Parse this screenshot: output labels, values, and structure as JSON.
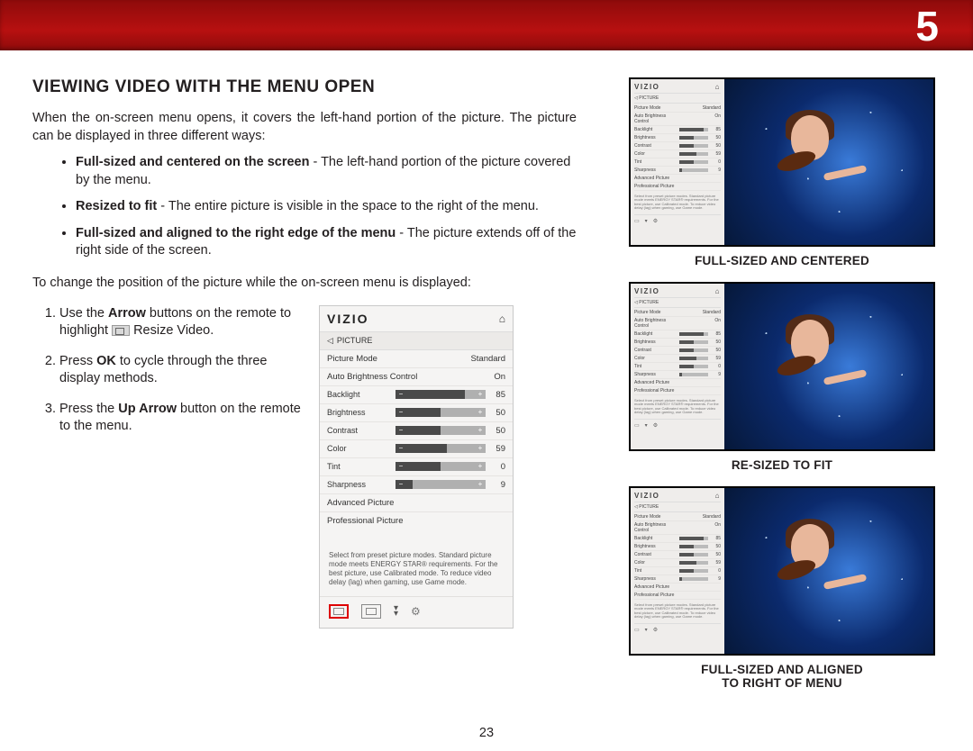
{
  "chapter": "5",
  "page_number": "23",
  "heading": "VIEWING VIDEO WITH THE MENU OPEN",
  "intro": "When the on-screen menu opens, it covers the left-hand portion of the picture. The picture can be displayed in three different ways:",
  "bullets": [
    {
      "bold": "Full-sized and centered on the screen",
      "rest": " - The left-hand portion of the picture covered by the menu."
    },
    {
      "bold": "Resized to fit",
      "rest": " - The entire picture is visible in the space to the right of the menu."
    },
    {
      "bold": "Full-sized and aligned to the right edge of the menu",
      "rest": " - The picture extends off of the right side of the screen."
    }
  ],
  "para2": "To change the position of the picture while the on-screen menu is displayed:",
  "steps": {
    "s1a": "Use the ",
    "s1b": "Arrow",
    "s1c": " buttons on the remote to highlight ",
    "s1d": " Resize Video.",
    "s2a": "Press ",
    "s2b": "OK",
    "s2c": " to cycle through the three display methods.",
    "s3a": "Press the ",
    "s3b": "Up Arrow",
    "s3c": " button on the remote to the menu."
  },
  "menu": {
    "brand": "VIZIO",
    "crumb": "PICTURE",
    "rows": {
      "picture_mode": {
        "label": "Picture Mode",
        "value": "Standard"
      },
      "auto_brightness": {
        "label": "Auto Brightness Control",
        "value": "On"
      },
      "backlight": {
        "label": "Backlight",
        "value": "85",
        "pct": 85
      },
      "brightness": {
        "label": "Brightness",
        "value": "50",
        "pct": 50
      },
      "contrast": {
        "label": "Contrast",
        "value": "50",
        "pct": 50
      },
      "color": {
        "label": "Color",
        "value": "59",
        "pct": 59
      },
      "tint": {
        "label": "Tint",
        "value": "0",
        "pct": 50
      },
      "sharpness": {
        "label": "Sharpness",
        "value": "9",
        "pct": 9
      },
      "advanced": {
        "label": "Advanced Picture"
      },
      "professional": {
        "label": "Professional Picture"
      }
    },
    "note": "Select from preset picture modes. Standard picture mode meets ENERGY STAR® requirements. For the best picture, use Calibrated mode. To reduce video delay (lag) when gaming, use Game mode."
  },
  "captions": {
    "full_centered": "FULL-SIZED AND CENTERED",
    "resized": "RE-SIZED TO FIT",
    "aligned_a": "FULL-SIZED AND ALIGNED",
    "aligned_b": "TO RIGHT OF MENU"
  },
  "mini_menu": {
    "brand": "VIZIO",
    "crumb": "PICTURE",
    "rows": [
      {
        "l": "Picture Mode",
        "v": "Standard"
      },
      {
        "l": "Auto Brightness Control",
        "v": "On"
      },
      {
        "l": "Backlight",
        "v": "85",
        "p": 85
      },
      {
        "l": "Brightness",
        "v": "50",
        "p": 50
      },
      {
        "l": "Contrast",
        "v": "50",
        "p": 50
      },
      {
        "l": "Color",
        "v": "59",
        "p": 59
      },
      {
        "l": "Tint",
        "v": "0",
        "p": 50
      },
      {
        "l": "Sharpness",
        "v": "9",
        "p": 9
      },
      {
        "l": "Advanced Picture",
        "v": ""
      },
      {
        "l": "Professional Picture",
        "v": ""
      }
    ],
    "note": "Select from preset picture modes. Standard picture mode meets ENERGY STAR® requirements. For the best picture, use Calibrated mode. To reduce video delay (lag) when gaming, use Game mode."
  }
}
